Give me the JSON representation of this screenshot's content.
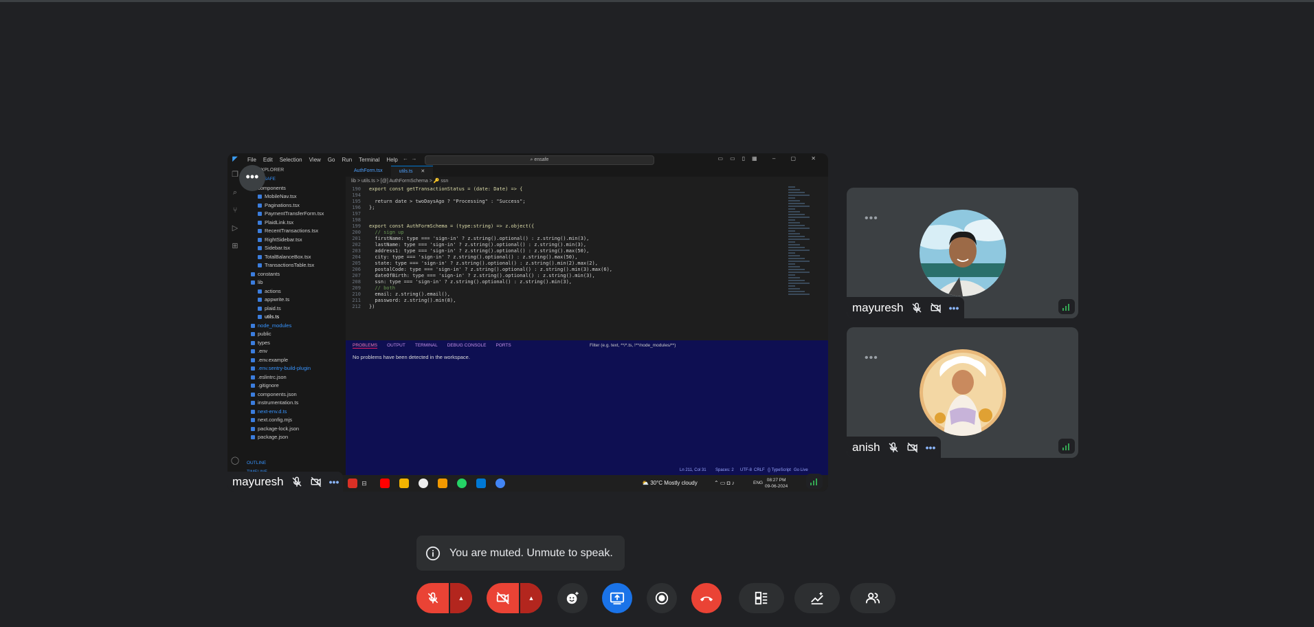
{
  "colors": {
    "background": "#202124",
    "red": "#ea4335",
    "blue": "#1a73e8",
    "tile": "#3c4043",
    "signal": "#34a853",
    "link": "#8ab4f8"
  },
  "shared_screen": {
    "presenter_name": "mayuresh",
    "vscode": {
      "menu": [
        "File",
        "Edit",
        "Selection",
        "View",
        "Go",
        "Run",
        "Terminal",
        "Help"
      ],
      "search": "ensafe",
      "tabs": [
        "AuthForm.tsx",
        "utils.ts"
      ],
      "breadcrumb": "lib > utils.ts > [@] AuthFormSchema > 🔑 ssn",
      "explorer_title": "EXPLORER",
      "explorer_root": "ENSAFE",
      "explorer_items": [
        {
          "label": "components",
          "indent": 1,
          "color": "#cccccc"
        },
        {
          "label": "MobileNav.tsx",
          "indent": 2,
          "color": "#cccccc"
        },
        {
          "label": "Paginations.tsx",
          "indent": 2,
          "color": "#cccccc"
        },
        {
          "label": "PaymentTransferForm.tsx",
          "indent": 2,
          "color": "#cccccc"
        },
        {
          "label": "PlaidLink.tsx",
          "indent": 2,
          "color": "#cccccc"
        },
        {
          "label": "RecentTransactions.tsx",
          "indent": 2,
          "color": "#cccccc"
        },
        {
          "label": "RightSidebar.tsx",
          "indent": 2,
          "color": "#cccccc"
        },
        {
          "label": "Sidebar.tsx",
          "indent": 2,
          "color": "#cccccc"
        },
        {
          "label": "TotalBalanceBox.tsx",
          "indent": 2,
          "color": "#cccccc"
        },
        {
          "label": "TransactionsTable.tsx",
          "indent": 2,
          "color": "#cccccc"
        },
        {
          "label": "constants",
          "indent": 1,
          "color": "#cccccc"
        },
        {
          "label": "lib",
          "indent": 1,
          "color": "#cccccc"
        },
        {
          "label": "actions",
          "indent": 2,
          "color": "#cccccc"
        },
        {
          "label": "appwrite.ts",
          "indent": 2,
          "color": "#cccccc"
        },
        {
          "label": "plaid.ts",
          "indent": 2,
          "color": "#cccccc"
        },
        {
          "label": "utils.ts",
          "indent": 2,
          "color": "#ffffff"
        },
        {
          "label": "node_modules",
          "indent": 1,
          "color": "#3794ff"
        },
        {
          "label": "public",
          "indent": 1,
          "color": "#cccccc"
        },
        {
          "label": "types",
          "indent": 1,
          "color": "#cccccc"
        },
        {
          "label": ".env",
          "indent": 1,
          "color": "#cccccc"
        },
        {
          "label": ".env.example",
          "indent": 1,
          "color": "#cccccc"
        },
        {
          "label": ".env.sentry-build-plugin",
          "indent": 1,
          "color": "#3794ff"
        },
        {
          "label": ".eslintrc.json",
          "indent": 1,
          "color": "#cccccc"
        },
        {
          "label": ".gitignore",
          "indent": 1,
          "color": "#cccccc"
        },
        {
          "label": "components.json",
          "indent": 1,
          "color": "#cccccc"
        },
        {
          "label": "instrumentation.ts",
          "indent": 1,
          "color": "#cccccc"
        },
        {
          "label": "next-env.d.ts",
          "indent": 1,
          "color": "#3794ff"
        },
        {
          "label": "next.config.mjs",
          "indent": 1,
          "color": "#cccccc"
        },
        {
          "label": "package-lock.json",
          "indent": 1,
          "color": "#cccccc"
        },
        {
          "label": "package.json",
          "indent": 1,
          "color": "#cccccc"
        }
      ],
      "outline": "OUTLINE",
      "timeline": "TIMELINE",
      "code_lines": [
        {
          "n": "190",
          "t": "export const getTransactionStatus = (date: Date) => {"
        },
        {
          "n": "194",
          "t": ""
        },
        {
          "n": "195",
          "t": "  return date > twoDaysAgo ? \"Processing\" : \"Success\";"
        },
        {
          "n": "196",
          "t": "};"
        },
        {
          "n": "197",
          "t": ""
        },
        {
          "n": "198",
          "t": ""
        },
        {
          "n": "199",
          "t": "export const AuthFormSchema = (type:string) => z.object({"
        },
        {
          "n": "200",
          "t": "  // sign up"
        },
        {
          "n": "201",
          "t": "  firstName: type === 'sign-in' ? z.string().optional() : z.string().min(3),"
        },
        {
          "n": "202",
          "t": "  lastName: type === 'sign-in' ? z.string().optional() : z.string().min(3),"
        },
        {
          "n": "203",
          "t": "  address1: type === 'sign-in' ? z.string().optional() : z.string().max(50),"
        },
        {
          "n": "204",
          "t": "  city: type === 'sign-in' ? z.string().optional() : z.string().max(50),"
        },
        {
          "n": "205",
          "t": "  state: type === 'sign-in' ? z.string().optional() : z.string().min(2).max(2),"
        },
        {
          "n": "206",
          "t": "  postalCode: type === 'sign-in' ? z.string().optional() : z.string().min(3).max(6),"
        },
        {
          "n": "207",
          "t": "  dateOfBirth: type === 'sign-in' ? z.string().optional() : z.string().min(3),"
        },
        {
          "n": "208",
          "t": "  ssn: type === 'sign-in' ? z.string().optional() : z.string().min(3),"
        },
        {
          "n": "209",
          "t": "  // both"
        },
        {
          "n": "210",
          "t": "  email: z.string().email(),"
        },
        {
          "n": "211",
          "t": "  password: z.string().min(8),"
        },
        {
          "n": "212",
          "t": "})"
        }
      ],
      "panel_tabs": [
        "PROBLEMS",
        "OUTPUT",
        "TERMINAL",
        "DEBUG CONSOLE",
        "PORTS"
      ],
      "panel_filter": "Filter (e.g. text, **/*.ts, !**/node_modules/**)",
      "panel_message": "No problems have been detected in the workspace.",
      "status": {
        "position": "Ln 211, Col 31",
        "spaces": "Spaces: 2",
        "encoding": "UTF-8",
        "eol": "CRLF",
        "language": "{} TypeScript",
        "golive": "Go Live"
      },
      "taskbar": {
        "weather": "30°C  Mostly cloudy",
        "lang": "ENG",
        "time": "08:27 PM",
        "date": "09-06-2024"
      }
    }
  },
  "participants": [
    {
      "name": "mayuresh"
    },
    {
      "name": "anish"
    }
  ],
  "toast": {
    "message": "You are muted. Unmute to speak."
  }
}
